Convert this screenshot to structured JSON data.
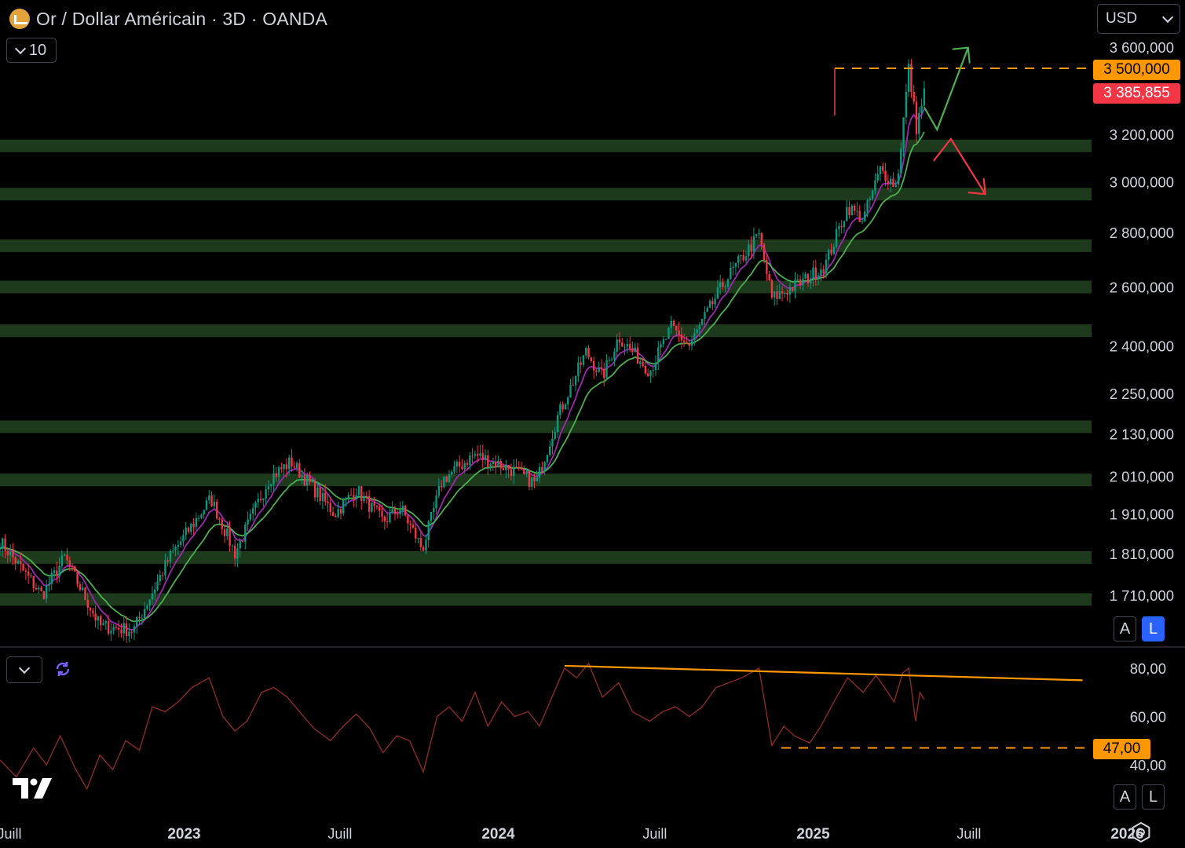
{
  "header": {
    "title": "Or / Dollar Américain · 3D · OANDA",
    "indicator_count": "10",
    "currency": "USD"
  },
  "colors": {
    "background": "#000000",
    "up_candle": "#089981",
    "down_candle": "#f23645",
    "zone_fill": "#1d3a1c",
    "ema_fast": "#9c27b0",
    "ema_slow": "#4caf50",
    "rsi_line": "#8b2a26",
    "orange_level": "#ff9800",
    "arrow_up": "#4caf50",
    "arrow_down": "#f23645"
  },
  "price_axis": {
    "labels": [
      "3 600,000",
      "3 200,000",
      "3 000,000",
      "2 800,000",
      "2 600,000",
      "2 400,000",
      "2 250,000",
      "2 130,000",
      "2 010,000",
      "1 910,000",
      "1 810,000",
      "1 710,000"
    ],
    "level_badge": "3 500,000",
    "last_price_badge": "3 385,855"
  },
  "rsi_axis": {
    "labels": [
      "80,00",
      "60,00",
      "40,00"
    ],
    "level_badge": "47,00"
  },
  "time_axis": {
    "labels": [
      "Juill",
      "2023",
      "Juill",
      "2024",
      "Juill",
      "2025",
      "Juill",
      "2026"
    ]
  },
  "scale_buttons": {
    "auto": "A",
    "log": "L"
  },
  "chart_data": [
    {
      "type": "candlestick",
      "symbol": "XAUUSD",
      "timeframe": "3D",
      "source": "OANDA",
      "scale": "log",
      "x_range": [
        "2022-06-01",
        "2026-03-10"
      ],
      "y_range": [
        1600,
        3650
      ],
      "price_path": [
        [
          "2022-06-01",
          1840
        ],
        [
          "2022-07-20",
          1710
        ],
        [
          "2022-08-15",
          1800
        ],
        [
          "2022-09-25",
          1640
        ],
        [
          "2022-11-03",
          1630
        ],
        [
          "2022-12-15",
          1800
        ],
        [
          "2023-02-01",
          1950
        ],
        [
          "2023-03-01",
          1810
        ],
        [
          "2023-04-10",
          2005
        ],
        [
          "2023-05-05",
          2050
        ],
        [
          "2023-06-25",
          1910
        ],
        [
          "2023-07-20",
          1975
        ],
        [
          "2023-08-20",
          1890
        ],
        [
          "2023-09-10",
          1925
        ],
        [
          "2023-10-05",
          1820
        ],
        [
          "2023-10-28",
          2000
        ],
        [
          "2023-12-04",
          2070
        ],
        [
          "2024-01-15",
          2030
        ],
        [
          "2024-02-14",
          1990
        ],
        [
          "2024-03-10",
          2180
        ],
        [
          "2024-04-12",
          2380
        ],
        [
          "2024-05-01",
          2300
        ],
        [
          "2024-05-20",
          2430
        ],
        [
          "2024-06-25",
          2320
        ],
        [
          "2024-07-20",
          2460
        ],
        [
          "2024-08-10",
          2400
        ],
        [
          "2024-09-20",
          2620
        ],
        [
          "2024-10-30",
          2790
        ],
        [
          "2024-11-14",
          2560
        ],
        [
          "2024-12-20",
          2620
        ],
        [
          "2025-01-15",
          2680
        ],
        [
          "2025-02-10",
          2900
        ],
        [
          "2025-02-28",
          2850
        ],
        [
          "2025-03-20",
          3050
        ],
        [
          "2025-04-08",
          2980
        ],
        [
          "2025-04-22",
          3500
        ],
        [
          "2025-05-01",
          3230
        ],
        [
          "2025-05-10",
          3385.855
        ]
      ],
      "moving_averages": [
        "fast",
        "slow"
      ],
      "support_zones": [
        3150,
        2950,
        2750,
        2600,
        2450,
        2150,
        2000,
        1800,
        1700
      ],
      "horizontal_level": 3500,
      "last_price": 3385.855,
      "projections": [
        {
          "direction": "up",
          "from": [
            "2025-05-10",
            3320
          ],
          "via": [
            "2025-05-25",
            3220
          ],
          "to": [
            "2025-06-30",
            3600
          ]
        },
        {
          "direction": "down",
          "from": [
            "2025-06-10",
            3180
          ],
          "to": [
            "2025-07-20",
            2950
          ]
        }
      ]
    },
    {
      "type": "line",
      "indicator": "RSI",
      "y_range": [
        30,
        88
      ],
      "levels": [
        47
      ],
      "trendline": {
        "from": [
          "2024-03-18",
          81
        ],
        "to": [
          "2025-11-10",
          75
        ]
      },
      "horizontal_segment": {
        "value": 47,
        "from": "2024-11-25"
      },
      "values": [
        [
          "2022-06-01",
          42
        ],
        [
          "2022-06-20",
          35
        ],
        [
          "2022-07-10",
          47
        ],
        [
          "2022-07-25",
          40
        ],
        [
          "2022-08-10",
          52
        ],
        [
          "2022-08-28",
          38
        ],
        [
          "2022-09-10",
          30
        ],
        [
          "2022-09-25",
          44
        ],
        [
          "2022-10-10",
          38
        ],
        [
          "2022-10-25",
          50
        ],
        [
          "2022-11-10",
          46
        ],
        [
          "2022-11-25",
          64
        ],
        [
          "2022-12-10",
          62
        ],
        [
          "2022-12-25",
          66
        ],
        [
          "2023-01-10",
          72
        ],
        [
          "2023-01-30",
          76
        ],
        [
          "2023-02-15",
          60
        ],
        [
          "2023-03-01",
          54
        ],
        [
          "2023-03-15",
          58
        ],
        [
          "2023-04-01",
          70
        ],
        [
          "2023-04-15",
          72
        ],
        [
          "2023-05-01",
          68
        ],
        [
          "2023-05-15",
          62
        ],
        [
          "2023-06-01",
          55
        ],
        [
          "2023-06-20",
          50
        ],
        [
          "2023-07-05",
          56
        ],
        [
          "2023-07-20",
          61
        ],
        [
          "2023-08-05",
          55
        ],
        [
          "2023-08-20",
          45
        ],
        [
          "2023-09-05",
          52
        ],
        [
          "2023-09-20",
          50
        ],
        [
          "2023-10-06",
          37
        ],
        [
          "2023-10-22",
          60
        ],
        [
          "2023-11-05",
          64
        ],
        [
          "2023-11-20",
          58
        ],
        [
          "2023-12-05",
          70
        ],
        [
          "2023-12-20",
          56
        ],
        [
          "2024-01-05",
          66
        ],
        [
          "2024-01-20",
          60
        ],
        [
          "2024-02-05",
          62
        ],
        [
          "2024-02-18",
          56
        ],
        [
          "2024-03-01",
          66
        ],
        [
          "2024-03-18",
          80
        ],
        [
          "2024-04-01",
          76
        ],
        [
          "2024-04-15",
          82
        ],
        [
          "2024-05-01",
          68
        ],
        [
          "2024-05-20",
          74
        ],
        [
          "2024-06-05",
          62
        ],
        [
          "2024-06-25",
          58
        ],
        [
          "2024-07-10",
          62
        ],
        [
          "2024-07-25",
          64
        ],
        [
          "2024-08-10",
          60
        ],
        [
          "2024-08-25",
          64
        ],
        [
          "2024-09-10",
          72
        ],
        [
          "2024-09-25",
          74
        ],
        [
          "2024-10-10",
          76
        ],
        [
          "2024-10-30",
          80
        ],
        [
          "2024-11-14",
          48
        ],
        [
          "2024-11-28",
          56
        ],
        [
          "2024-12-10",
          52
        ],
        [
          "2024-12-28",
          49
        ],
        [
          "2025-01-10",
          56
        ],
        [
          "2025-01-25",
          66
        ],
        [
          "2025-02-10",
          76
        ],
        [
          "2025-02-28",
          70
        ],
        [
          "2025-03-15",
          77
        ],
        [
          "2025-03-25",
          72
        ],
        [
          "2025-04-05",
          66
        ],
        [
          "2025-04-15",
          78
        ],
        [
          "2025-04-22",
          80
        ],
        [
          "2025-04-30",
          58
        ],
        [
          "2025-05-05",
          70
        ],
        [
          "2025-05-10",
          67
        ]
      ]
    }
  ]
}
